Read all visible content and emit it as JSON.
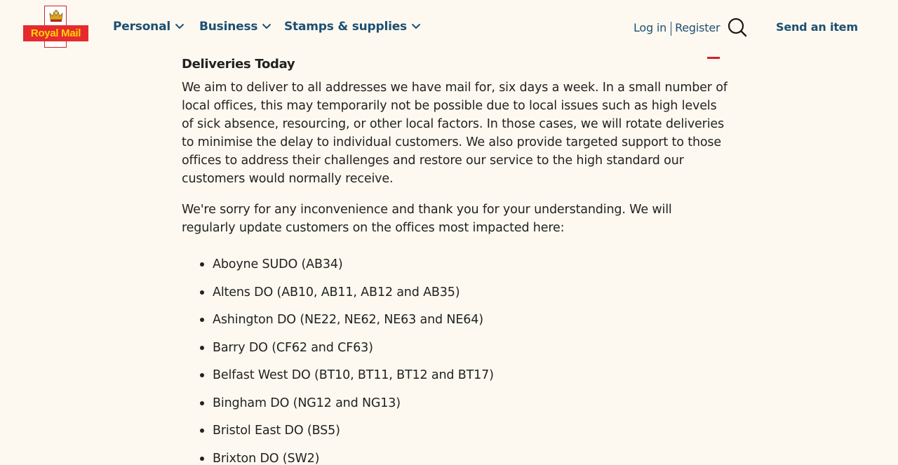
{
  "header": {
    "logo_text": "Royal Mail",
    "nav": [
      {
        "label": "Personal"
      },
      {
        "label": "Business"
      },
      {
        "label": "Stamps & supplies"
      }
    ],
    "login_label": "Log in",
    "register_label": "Register",
    "search_icon": "search-icon",
    "send_label": "Send an item"
  },
  "content": {
    "heading": "Deliveries Today",
    "paragraph1": "We aim to deliver to all addresses we have mail for, six days a week. In a small number of local offices, this may temporarily not be possible due to local issues such as high levels of sick absence, resourcing, or other local factors. In those cases, we will rotate deliveries to minimise the delay to individual customers. We also provide targeted support to those offices to address their challenges and restore our service to the high standard our customers would normally receive.",
    "paragraph2": "We're sorry for any inconvenience and thank you for your understanding. We will regularly update customers on the offices most impacted here:",
    "offices": [
      "Aboyne SUDO (AB34)",
      "Altens DO (AB10, AB11, AB12 and AB35)",
      "Ashington DO (NE22, NE62, NE63 and NE64)",
      "Barry DO (CF62 and CF63)",
      "Belfast West DO (BT10, BT11, BT12 and BT17)",
      "Bingham DO (NG12 and NG13)",
      "Bristol East DO (BS5)",
      "Brixton DO (SW2)"
    ]
  },
  "colors": {
    "background": "#fdf9f0",
    "brand_red": "#e52b2f",
    "brand_yellow": "#ffd400",
    "nav_blue": "#1d4f72",
    "text": "#222222"
  }
}
